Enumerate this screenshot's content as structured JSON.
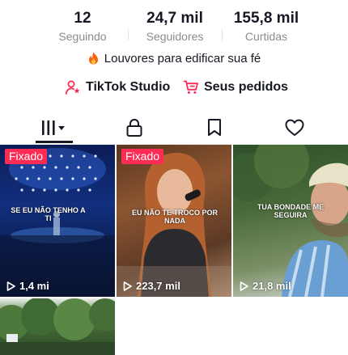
{
  "stats": {
    "following": {
      "value": "12",
      "label": "Seguindo"
    },
    "followers": {
      "value": "24,7 mil",
      "label": "Seguidores"
    },
    "likes": {
      "value": "155,8 mil",
      "label": "Curtidas"
    }
  },
  "bio": {
    "icon": "fire-icon",
    "text": "Louvores para edificar sua fé"
  },
  "links": {
    "studio": {
      "icon": "studio-icon",
      "label": "TikTok Studio"
    },
    "orders": {
      "icon": "cart-icon",
      "label": "Seus pedidos"
    }
  },
  "tabs": [
    {
      "name": "videos",
      "icon": "grid-bars-icon",
      "active": true
    },
    {
      "name": "private",
      "icon": "lock-icon"
    },
    {
      "name": "saved",
      "icon": "bookmark-icon"
    },
    {
      "name": "liked",
      "icon": "heart-icon"
    }
  ],
  "videos": [
    {
      "pinned": true,
      "pin_label": "Fixado",
      "overlay": "SE EU NÃO TENHO A TI",
      "views": "1,4 mi"
    },
    {
      "pinned": true,
      "pin_label": "Fixado",
      "overlay": "EU NÃO TE TROCO POR NADA",
      "views": "223,7 mil"
    },
    {
      "pinned": false,
      "overlay": "TUA BONDADE ME SEGUIRA",
      "views": "21,8 mil"
    },
    {
      "pinned": false
    }
  ],
  "colors": {
    "accent": "#fe2c55",
    "text": "#161823",
    "muted": "#8a8b91"
  }
}
